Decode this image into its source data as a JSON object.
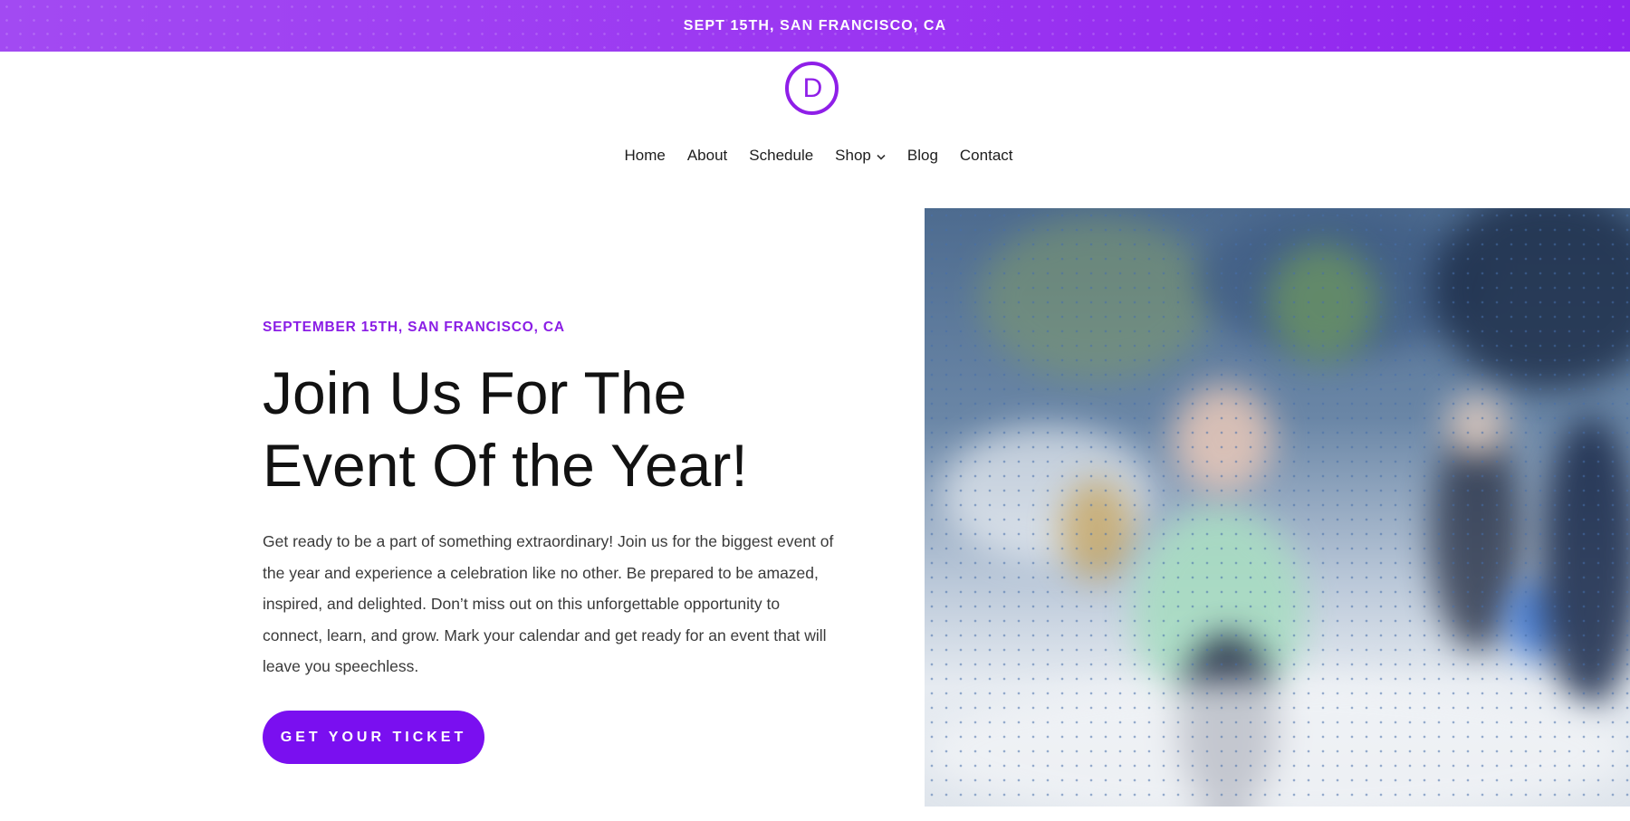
{
  "topbar": {
    "text": "SEPT 15TH, SAN FRANCISCO, CA"
  },
  "logo": {
    "letter": "D"
  },
  "nav": {
    "items": [
      {
        "label": "Home"
      },
      {
        "label": "About"
      },
      {
        "label": "Schedule"
      },
      {
        "label": "Shop",
        "has_dropdown": true
      },
      {
        "label": "Blog"
      },
      {
        "label": "Contact"
      }
    ]
  },
  "hero": {
    "eyebrow": "SEPTEMBER 15TH, SAN FRANCISCO, CA",
    "headline_line1": "Join Us For The",
    "headline_line2": "Event Of the Year!",
    "body": "Get ready to be a part of something extraordinary! Join us for the biggest event of the year and experience a celebration like no other. Be prepared to be amazed, inspired, and delighted. Don’t miss out on this unforgettable opportunity to connect, learn, and grow. Mark your calendar and get ready for an event that will leave you speechless.",
    "cta_label": "GET YOUR TICKET",
    "image": "blurred-crowd-photo"
  },
  "colors": {
    "accent": "#7a0ff0",
    "topbar": "#9b2ff0",
    "eyebrow": "#8a1de5"
  },
  "icons": {
    "dropdown": "chevron-down-icon"
  }
}
